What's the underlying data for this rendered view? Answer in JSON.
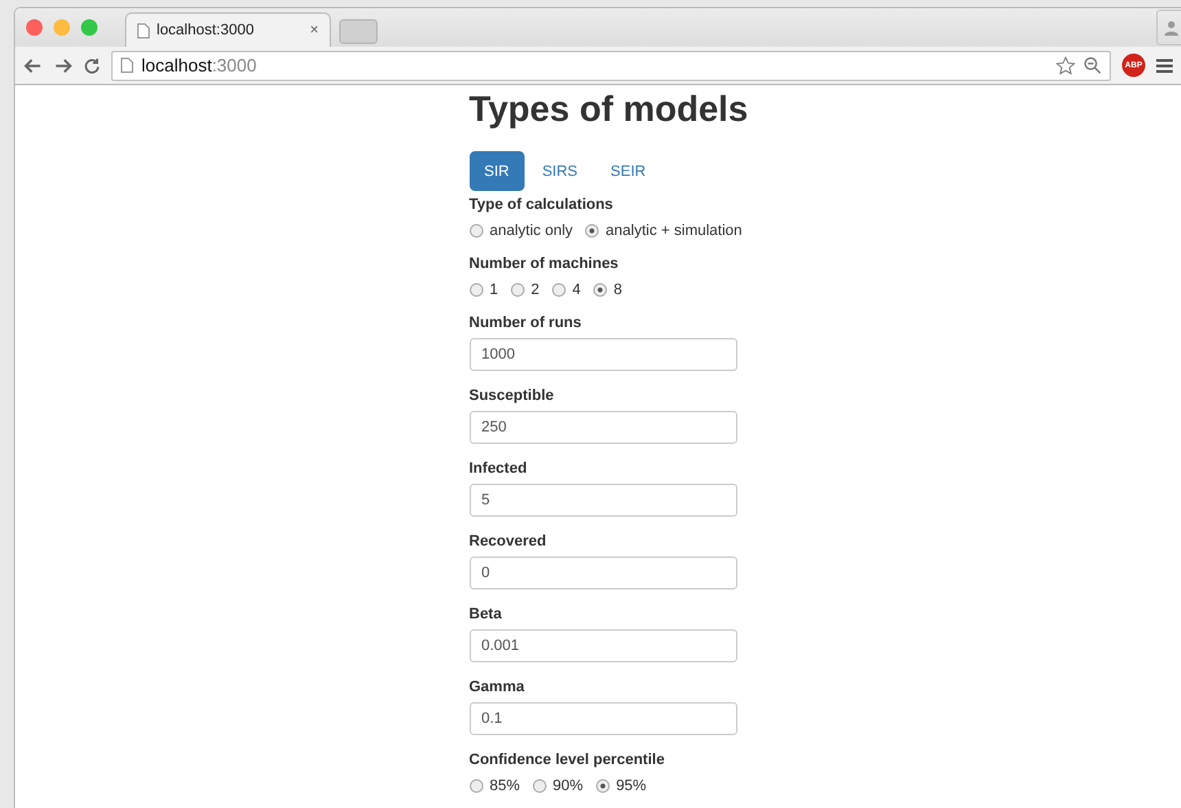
{
  "browser": {
    "tab_title": "localhost:3000",
    "tab_close": "×",
    "url_host": "localhost",
    "url_port": ":3000",
    "extension_badge": "ABP"
  },
  "page": {
    "title": "Types of models",
    "tabs": [
      {
        "label": "SIR",
        "selected": true
      },
      {
        "label": "SIRS",
        "selected": false
      },
      {
        "label": "SEIR",
        "selected": false
      }
    ],
    "fields": [
      {
        "kind": "radio",
        "label": "Type of calculations",
        "options": [
          {
            "label": "analytic only",
            "selected": false
          },
          {
            "label": "analytic + simulation",
            "selected": true
          }
        ]
      },
      {
        "kind": "radio",
        "label": "Number of machines",
        "options": [
          {
            "label": "1",
            "selected": false
          },
          {
            "label": "2",
            "selected": false
          },
          {
            "label": "4",
            "selected": false
          },
          {
            "label": "8",
            "selected": true
          }
        ]
      },
      {
        "kind": "input",
        "label": "Number of runs",
        "value": "1000"
      },
      {
        "kind": "input",
        "label": "Susceptible",
        "value": "250"
      },
      {
        "kind": "input",
        "label": "Infected",
        "value": "5"
      },
      {
        "kind": "input",
        "label": "Recovered",
        "value": "0"
      },
      {
        "kind": "input",
        "label": "Beta",
        "value": "0.001"
      },
      {
        "kind": "input",
        "label": "Gamma",
        "value": "0.1"
      },
      {
        "kind": "radio",
        "label": "Confidence level percentile",
        "options": [
          {
            "label": "85%",
            "selected": false
          },
          {
            "label": "90%",
            "selected": false
          },
          {
            "label": "95%",
            "selected": true
          }
        ]
      }
    ]
  }
}
